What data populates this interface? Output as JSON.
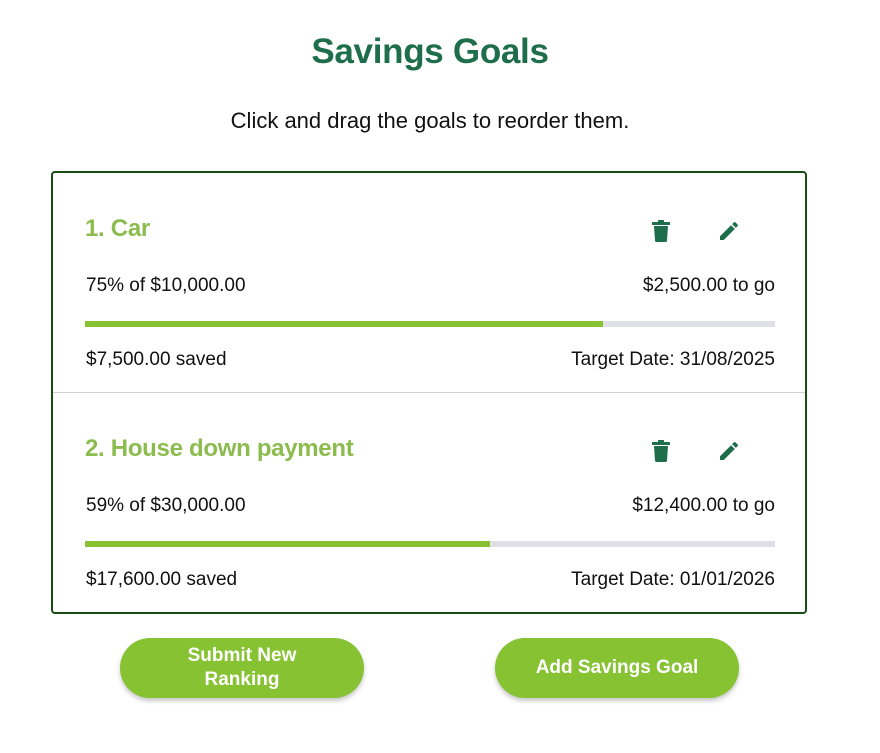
{
  "page": {
    "title": "Savings Goals",
    "instructions": "Click and drag the goals to reorder them."
  },
  "colors": {
    "title": "#1e6e4c",
    "goal_name": "#8cbc4e",
    "icon": "#1e6e4c",
    "progress_fill": "#86c232",
    "progress_track": "#dfe1e6",
    "border": "#174d12",
    "button_bg": "#86c232",
    "button_text": "#ffffff"
  },
  "goals": [
    {
      "name": "1. Car",
      "percent_text": "75% of $10,000.00",
      "to_go_text": "$2,500.00 to go",
      "progress_fraction": 0.75,
      "saved_text": "$7,500.00 saved",
      "target_date_text": "Target Date: 31/08/2025",
      "delete_icon": "trash-icon",
      "edit_icon": "pencil-icon"
    },
    {
      "name": "2. House down payment",
      "percent_text": "59% of $30,000.00",
      "to_go_text": "$12,400.00 to go",
      "progress_fraction": 0.5866,
      "saved_text": "$17,600.00 saved",
      "target_date_text": "Target Date: 01/01/2026",
      "delete_icon": "trash-icon",
      "edit_icon": "pencil-icon"
    }
  ],
  "buttons": {
    "submit_label": "Submit New Ranking",
    "add_label": "Add Savings Goal"
  }
}
